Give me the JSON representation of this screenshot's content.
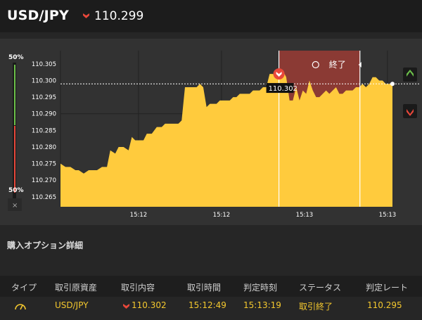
{
  "header": {
    "pair": "USD/JPY",
    "price": "110.299",
    "price_direction_icon": "down-arrow-icon",
    "down_color": "#e8473a"
  },
  "chart": {
    "left_gauge": {
      "top_label": "50%",
      "bottom_label": "50%",
      "close_label": "×",
      "up_color": "#6cc04a",
      "down_color": "#e8473a"
    },
    "end_label": "終了",
    "entry_label": "110.302",
    "fill_color": "#ffcb3d",
    "expiry_zone_color": "#8b3a34"
  },
  "chart_data": {
    "type": "area",
    "x_tick_labels": [
      "15:12",
      "15:12",
      "15:13",
      "15:13"
    ],
    "y_ticks": [
      110.265,
      110.27,
      110.275,
      110.28,
      110.285,
      110.29,
      110.295,
      110.3,
      110.305
    ],
    "y_tick_labels": [
      "110.265",
      "110.270",
      "110.275",
      "110.280",
      "110.285",
      "110.290",
      "110.295",
      "110.300",
      "110.305"
    ],
    "ylim": [
      110.262,
      110.309
    ],
    "xlim": [
      0,
      100
    ],
    "current_price": 110.299,
    "entry": {
      "x": 65.8,
      "y": 110.302
    },
    "entry_time_x": 65.8,
    "expiry_time_x": 90.2,
    "vertical_line_x": 65.8,
    "x": [
      0,
      1.5,
      3,
      4.5,
      5.5,
      7,
      8.5,
      10,
      11,
      12.5,
      14,
      15,
      16.5,
      17.5,
      19,
      20.5,
      21.5,
      22.5,
      24,
      25,
      26,
      27.5,
      29,
      30.5,
      31.5,
      32.5,
      34,
      35.5,
      36.5,
      37.5,
      38.5,
      39.5,
      41,
      42,
      43,
      44,
      45,
      46,
      47,
      48,
      49,
      50,
      51,
      52,
      53,
      54,
      55,
      56,
      57,
      58,
      59,
      60,
      61,
      62,
      63,
      64,
      65,
      66,
      67,
      68,
      69,
      70,
      71,
      72,
      73,
      74,
      75,
      76,
      77,
      78,
      79,
      80,
      81,
      82,
      83,
      84,
      85,
      86,
      87,
      88,
      89,
      90,
      91,
      92,
      93,
      94,
      95,
      96,
      97,
      98,
      99,
      100
    ],
    "y": [
      110.275,
      110.274,
      110.274,
      110.273,
      110.273,
      110.272,
      110.273,
      110.273,
      110.273,
      110.274,
      110.274,
      110.279,
      110.278,
      110.28,
      110.28,
      110.279,
      110.283,
      110.282,
      110.282,
      110.282,
      110.284,
      110.284,
      110.286,
      110.286,
      110.287,
      110.287,
      110.287,
      110.287,
      110.288,
      110.298,
      110.298,
      110.298,
      110.298,
      110.299,
      110.298,
      110.292,
      110.293,
      110.293,
      110.293,
      110.294,
      110.294,
      110.294,
      110.294,
      110.295,
      110.295,
      110.296,
      110.296,
      110.296,
      110.296,
      110.297,
      110.297,
      110.297,
      110.298,
      110.298,
      110.302,
      110.302,
      110.301,
      110.301,
      110.303,
      110.301,
      110.294,
      110.294,
      110.298,
      110.294,
      110.297,
      110.296,
      110.3,
      110.297,
      110.295,
      110.295,
      110.296,
      110.297,
      110.296,
      110.297,
      110.298,
      110.296,
      110.296,
      110.297,
      110.297,
      110.297,
      110.298,
      110.298,
      110.299,
      110.298,
      110.299,
      110.301,
      110.301,
      110.3,
      110.3,
      110.299,
      110.299,
      110.299
    ]
  },
  "details": {
    "title": "購入オプション詳細",
    "columns": [
      "タイプ",
      "取引原資産",
      "取引内容",
      "取引時間",
      "判定時刻",
      "ステータス",
      "判定レート"
    ],
    "row": {
      "type_icon": "gauge-icon",
      "asset": "USD/JPY",
      "content_icon": "down-arrow-icon",
      "content": "110.302",
      "trade_time": "15:12:49",
      "judge_time": "15:13:19",
      "status": "取引終了",
      "judge_rate": "110.295"
    }
  }
}
